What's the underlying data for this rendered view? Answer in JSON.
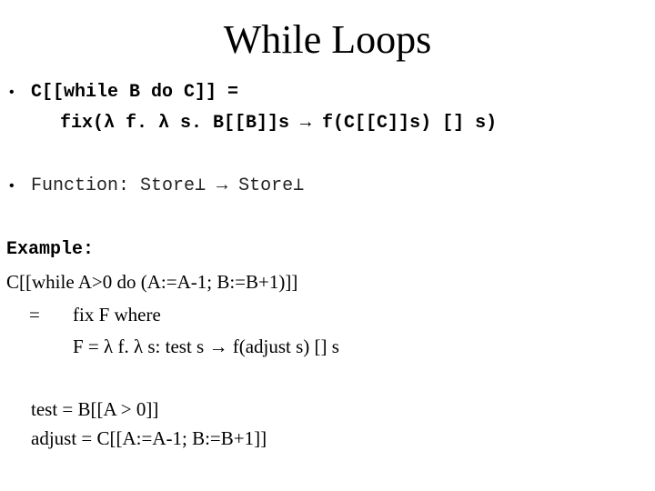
{
  "slide": {
    "title": "While Loops",
    "bullets": [
      {
        "marker": "•",
        "lines": [
          "C[[while B do C]] =",
          "fix(λ f. λ s. B[[B]]s → f(C[[C]]s) [] s)"
        ]
      },
      {
        "marker": "•",
        "lines": [
          "Function: Store⊥ → Store⊥"
        ]
      }
    ],
    "example": {
      "heading": "Example:",
      "lines": [
        "C[[while A>0 do (A:=A-1; B:=B+1)]]",
        "=",
        "fix F where",
        "F = λ f. λ s: test s → f(adjust s) [] s",
        "test = B[[A > 0]]",
        "adjust = C[[A:=A-1; B:=B+1]]"
      ]
    }
  }
}
